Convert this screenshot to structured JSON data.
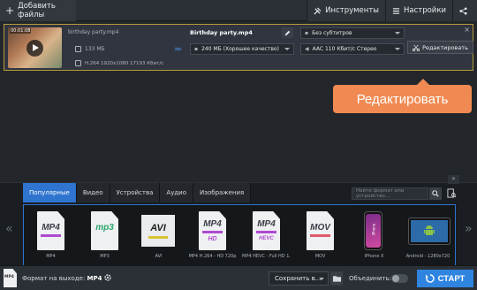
{
  "toolbar": {
    "add_files": "Добавить файлы",
    "tools": "Инструменты",
    "settings": "Настройки"
  },
  "file": {
    "timecode": "00:01:08",
    "source_name": "birthday party.mp4",
    "source_size": "133 МБ",
    "source_codec": "H.264 1920x1080 17193 Кбит/с",
    "output_name": "Birthday party.mp4",
    "quality": "240 МБ (Хорошее качество)",
    "subtitles": "Без субтитров",
    "audio": "AAC 110 Кбит/с Стерео",
    "edit_button": "Редактировать",
    "close": "×"
  },
  "tooltip": {
    "text": "Редактировать"
  },
  "formats": {
    "tabs": [
      "Популярные",
      "Видео",
      "Устройства",
      "Аудио",
      "Изображения"
    ],
    "active_tab": 0,
    "search_placeholder": "Найти формат или устройство...",
    "presets": [
      {
        "label": "MP4",
        "icon": "mp4-icon"
      },
      {
        "label": "MP3",
        "icon": "mp3-icon"
      },
      {
        "label": "AVI",
        "icon": "avi-icon"
      },
      {
        "label": "MP4 H.264 - HD 720p",
        "icon": "mp4-hd-icon"
      },
      {
        "label": "MP4 HEVC - Full HD 1...",
        "icon": "mp4-hevc-icon"
      },
      {
        "label": "MOV",
        "icon": "mov-icon"
      },
      {
        "label": "iPhone X",
        "icon": "iphone-icon"
      },
      {
        "label": "Android - 1280x720",
        "icon": "android-icon"
      }
    ],
    "card_texts": {
      "mp4": "MP4",
      "mp3": "mp3",
      "avi": "AVI",
      "hd": "HD",
      "hevc": "HEVC",
      "mov": "MOV",
      "iphone": "iPhone"
    }
  },
  "bottom": {
    "output_format_label": "Формат на выходе:",
    "output_format_value": "MP4",
    "output_icon_text": "MP4",
    "save_to": "Сохранить в...",
    "merge": "Объединить:",
    "start": "СТАРТ"
  },
  "colors": {
    "accent": "#2f74cf",
    "tooltip": "#f08a52",
    "selection_border": "#b89a3a",
    "start": "#2f84e0"
  }
}
